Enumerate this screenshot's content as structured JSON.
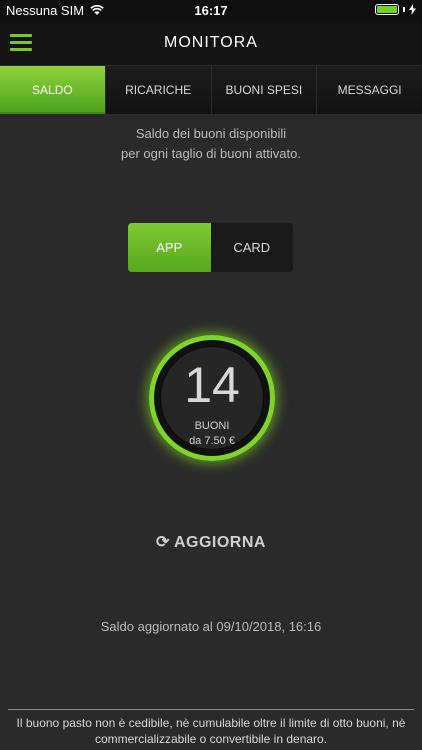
{
  "status": {
    "carrier": "Nessuna SIM",
    "time": "16:17"
  },
  "header": {
    "title": "MONITORA"
  },
  "tabs": [
    {
      "label": "SALDO",
      "active": true
    },
    {
      "label": "RICARICHE",
      "active": false
    },
    {
      "label": "BUONI SPESI",
      "active": false
    },
    {
      "label": "MESSAGGI",
      "active": false
    }
  ],
  "description": {
    "line1": "Saldo dei buoni disponibili",
    "line2": "per ogni taglio di buoni attivato."
  },
  "toggle": {
    "app": "APP",
    "card": "CARD",
    "selected": "APP"
  },
  "counter": {
    "value": "14",
    "label": "BUONI",
    "denomination": "da 7.50 €"
  },
  "refresh": {
    "label": "AGGIORNA"
  },
  "updated": {
    "text": "Saldo aggiornato al 09/10/2018, 16:16"
  },
  "footer": {
    "line1": "Il buono pasto non è cedibile, nè cumulabile oltre il limite di otto buoni, nè",
    "line2": "commercializzabile o convertibile in denaro."
  },
  "colors": {
    "accent": "#7fc933",
    "background": "#2a2a2a"
  }
}
